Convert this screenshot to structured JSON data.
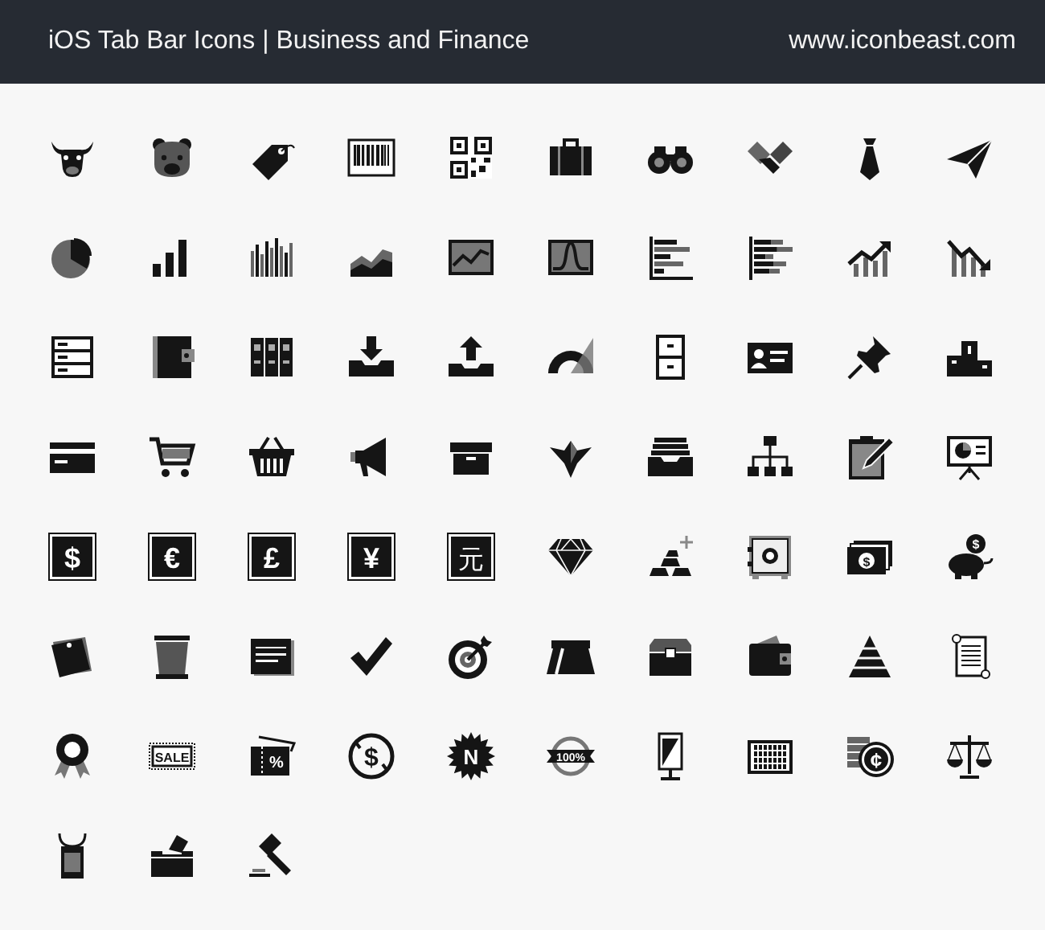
{
  "header": {
    "title": "iOS Tab Bar Icons | Business and Finance",
    "site": "www.iconbeast.com"
  },
  "icon_glyphs": [
    "$",
    "€",
    "£",
    "¥",
    "元",
    "$",
    "$",
    "SALE",
    "%",
    "$",
    "N",
    "100%",
    "¢"
  ]
}
